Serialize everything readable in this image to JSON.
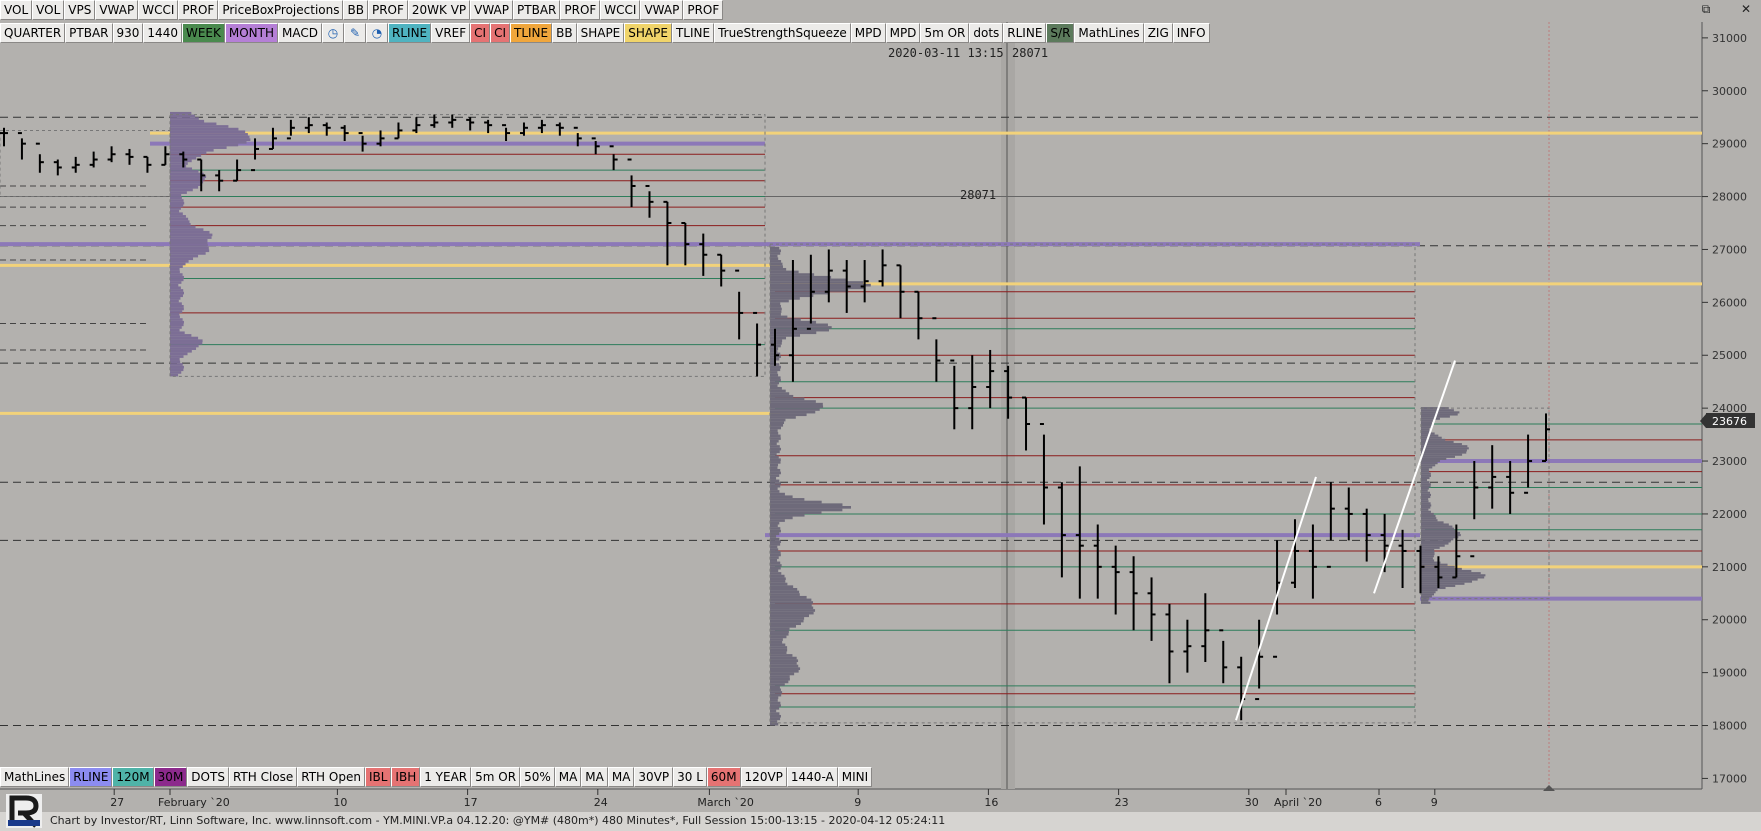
{
  "toolbar_top": [
    "VOL",
    "VOL",
    "VPS",
    "VWAP",
    "WCCI",
    "PROF",
    "PriceBoxProjections",
    "BB",
    "PROF",
    "20WK VP",
    "VWAP",
    "PTBAR",
    "PROF",
    "WCCI",
    "VWAP",
    "PROF"
  ],
  "toolbar_second": [
    {
      "label": "QUARTER",
      "color": "#ecebe9"
    },
    {
      "label": "PTBAR",
      "color": "#ecebe9"
    },
    {
      "label": "930",
      "color": "#ecebe9"
    },
    {
      "label": "1440",
      "color": "#ecebe9"
    },
    {
      "label": "WEEK",
      "color": "#4a8a4e"
    },
    {
      "label": "MONTH",
      "color": "#b57fd6"
    },
    {
      "label": "MACD",
      "color": "#ecebe9"
    },
    {
      "icon": "clock-icon",
      "glyph": "◷"
    },
    {
      "icon": "pencil-icon",
      "glyph": "✎"
    },
    {
      "icon": "cursor-icon",
      "glyph": "◔"
    },
    {
      "label": "RLINE",
      "color": "#4fb3c0"
    },
    {
      "label": "VREF",
      "color": "#ecebe9"
    },
    {
      "label": "CI",
      "color": "#e57373"
    },
    {
      "label": "CI",
      "color": "#e57373"
    },
    {
      "label": "TLINE",
      "color": "#f0a63c"
    },
    {
      "label": "BB",
      "color": "#ecebe9"
    },
    {
      "label": "SHAPE",
      "color": "#ecebe9"
    },
    {
      "label": "SHAPE",
      "color": "#f0d46a"
    },
    {
      "label": "TLINE",
      "color": "#ecebe9"
    },
    {
      "label": "TrueStrengthSqueeze",
      "color": "#ecebe9"
    },
    {
      "label": "MPD",
      "color": "#ecebe9"
    },
    {
      "label": "MPD",
      "color": "#ecebe9"
    },
    {
      "label": "5m OR",
      "color": "#ecebe9"
    },
    {
      "label": "dots",
      "color": "#ecebe9"
    },
    {
      "label": "RLINE",
      "color": "#ecebe9"
    },
    {
      "label": "S/R",
      "color": "#5c7a5c"
    },
    {
      "label": "MathLines",
      "color": "#ecebe9"
    },
    {
      "label": "ZIG",
      "color": "#ecebe9"
    },
    {
      "label": "INFO",
      "color": "#ecebe9"
    }
  ],
  "toolbar_bottom": [
    {
      "label": "MathLines",
      "color": "#ecebe9"
    },
    {
      "label": "RLINE",
      "color": "#8c8cf0"
    },
    {
      "label": "120M",
      "color": "#4fb3a8"
    },
    {
      "label": "30M",
      "color": "#8c2a8c"
    },
    {
      "label": "DOTS",
      "color": "#ecebe9"
    },
    {
      "label": "RTH Close",
      "color": "#ecebe9"
    },
    {
      "label": "RTH Open",
      "color": "#ecebe9"
    },
    {
      "label": "IBL",
      "color": "#e57373"
    },
    {
      "label": "IBH",
      "color": "#e57373"
    },
    {
      "label": "1 YEAR",
      "color": "#ecebe9"
    },
    {
      "label": "5m OR",
      "color": "#ecebe9"
    },
    {
      "label": "50%",
      "color": "#ecebe9"
    },
    {
      "label": "MA",
      "color": "#ecebe9"
    },
    {
      "label": "MA",
      "color": "#ecebe9"
    },
    {
      "label": "MA",
      "color": "#ecebe9"
    },
    {
      "label": "30VP",
      "color": "#ecebe9"
    },
    {
      "label": "30 L",
      "color": "#ecebe9"
    },
    {
      "label": "60M",
      "color": "#e57373"
    },
    {
      "label": "120VP",
      "color": "#ecebe9"
    },
    {
      "label": "1440-A",
      "color": "#ecebe9"
    },
    {
      "label": "MINI",
      "color": "#ecebe9"
    }
  ],
  "crosshair_label": "2020-03-11 13:15",
  "crosshair_value": "28071",
  "price_label": "28071",
  "last_price": "23676",
  "status_text": "Chart by Investor/RT, Linn Software, Inc. www.linnsoft.com - YM.MINI.VP.a      04.12.20: @YM# (480m*) 480 Minutes*, Full Session 15:00-13:15 - 2020-04-12 05:24:11",
  "window_controls": {
    "restore": "⧉",
    "close": "✕"
  },
  "chart_data": {
    "type": "bar",
    "description_none": "",
    "yaxis_ticks": [
      31000,
      30000,
      29000,
      28000,
      27000,
      26000,
      25000,
      24000,
      23000,
      22000,
      21000,
      20000,
      19000,
      18000,
      17000
    ],
    "ylim": [
      16800,
      31300
    ],
    "xaxis_ticks": [
      {
        "label": "27",
        "day": -3
      },
      {
        "label": "February `20",
        "day": 0
      },
      {
        "label": "10",
        "day": 9
      },
      {
        "label": "17",
        "day": 16
      },
      {
        "label": "24",
        "day": 23
      },
      {
        "label": "March `20",
        "day": 29
      },
      {
        "label": "9",
        "day": 37
      },
      {
        "label": "16",
        "day": 44
      },
      {
        "label": "23",
        "day": 51
      },
      {
        "label": "30",
        "day": 58
      },
      {
        "label": "April `20",
        "day": 60
      },
      {
        "label": "6",
        "day": 65
      },
      {
        "label": "9",
        "day": 68
      }
    ],
    "price_bars": [
      [
        29200,
        29300,
        28950
      ],
      [
        29000,
        29100,
        28700
      ],
      [
        28650,
        28800,
        28450
      ],
      [
        28550,
        28700,
        28400
      ],
      [
        28600,
        28750,
        28450
      ],
      [
        28700,
        28850,
        28550
      ],
      [
        28800,
        28950,
        28650
      ],
      [
        28750,
        28900,
        28600
      ],
      [
        28600,
        28750,
        28450
      ],
      [
        28800,
        28950,
        28600
      ],
      [
        28700,
        28850,
        28550
      ],
      [
        28400,
        28700,
        28100
      ],
      [
        28300,
        28500,
        28100
      ],
      [
        28500,
        28700,
        28300
      ],
      [
        28900,
        29100,
        28700
      ],
      [
        29100,
        29300,
        28900
      ],
      [
        29300,
        29450,
        29150
      ],
      [
        29350,
        29500,
        29200
      ],
      [
        29300,
        29400,
        29150
      ],
      [
        29200,
        29350,
        29050
      ],
      [
        29000,
        29150,
        28850
      ],
      [
        29100,
        29250,
        28950
      ],
      [
        29250,
        29400,
        29100
      ],
      [
        29350,
        29500,
        29200
      ],
      [
        29400,
        29550,
        29300
      ],
      [
        29450,
        29550,
        29300
      ],
      [
        29400,
        29500,
        29250
      ],
      [
        29350,
        29450,
        29200
      ],
      [
        29200,
        29300,
        29050
      ],
      [
        29300,
        29400,
        29150
      ],
      [
        29350,
        29450,
        29200
      ],
      [
        29300,
        29400,
        29150
      ],
      [
        29100,
        29200,
        28950
      ],
      [
        28950,
        29050,
        28800
      ],
      [
        28700,
        28800,
        28500
      ],
      [
        28200,
        28400,
        27800
      ],
      [
        27900,
        28100,
        27600
      ],
      [
        27500,
        27900,
        26700
      ],
      [
        27100,
        27500,
        26700
      ],
      [
        26900,
        27300,
        26500
      ],
      [
        26600,
        26900,
        26300
      ],
      [
        25800,
        26200,
        25300
      ],
      [
        25200,
        25600,
        24600
      ],
      [
        25000,
        25500,
        24800
      ],
      [
        25500,
        26800,
        24500
      ],
      [
        26200,
        26900,
        25600
      ],
      [
        26600,
        27000,
        26000
      ],
      [
        26300,
        26800,
        25800
      ],
      [
        26400,
        26800,
        26000
      ],
      [
        26700,
        27000,
        26300
      ],
      [
        26200,
        26700,
        25700
      ],
      [
        25700,
        26200,
        25300
      ],
      [
        24900,
        25300,
        24500
      ],
      [
        24000,
        24800,
        23600
      ],
      [
        24400,
        25000,
        23600
      ],
      [
        24700,
        25100,
        24000
      ],
      [
        24200,
        24800,
        23800
      ],
      [
        23700,
        24200,
        23200
      ],
      [
        22500,
        23500,
        21800
      ],
      [
        21600,
        22600,
        20800
      ],
      [
        21400,
        22900,
        20400
      ],
      [
        21000,
        21800,
        20400
      ],
      [
        20900,
        21400,
        20100
      ],
      [
        20500,
        21200,
        19800
      ],
      [
        20100,
        20800,
        19600
      ],
      [
        19400,
        20300,
        18800
      ],
      [
        19500,
        20000,
        19000
      ],
      [
        19800,
        20500,
        19200
      ],
      [
        19100,
        19600,
        18800
      ],
      [
        18500,
        19300,
        18100
      ],
      [
        19300,
        20000,
        18700
      ],
      [
        20700,
        21500,
        20100
      ],
      [
        21300,
        21900,
        20600
      ],
      [
        21000,
        21800,
        20400
      ],
      [
        22100,
        22600,
        21500
      ],
      [
        22000,
        22500,
        21500
      ],
      [
        21600,
        22100,
        21100
      ],
      [
        21400,
        22000,
        20900
      ],
      [
        21300,
        21700,
        20600
      ],
      [
        21000,
        21400,
        20500
      ],
      [
        20800,
        21200,
        20600
      ],
      [
        21200,
        21800,
        20800
      ],
      [
        22500,
        23000,
        21900
      ],
      [
        22700,
        23300,
        22100
      ],
      [
        22400,
        23000,
        22000
      ],
      [
        23000,
        23500,
        22500
      ],
      [
        23600,
        23900,
        23000
      ]
    ],
    "current_value": 23676
  }
}
